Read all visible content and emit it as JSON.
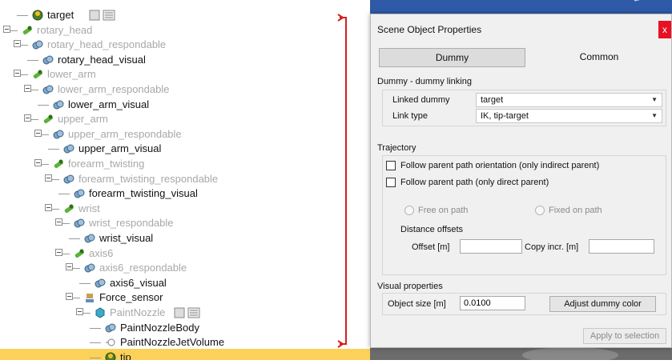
{
  "tree": {
    "rows": [
      {
        "label": "target",
        "style": "dark",
        "icon": "dummy-icon"
      },
      {
        "label": "rotary_head",
        "style": "dim",
        "icon": "joint-icon"
      },
      {
        "label": "rotary_head_respondable",
        "style": "dim",
        "icon": "shape-icon"
      },
      {
        "label": "rotary_head_visual",
        "style": "dark",
        "icon": "shape-icon"
      },
      {
        "label": "lower_arm",
        "style": "dim",
        "icon": "joint-icon"
      },
      {
        "label": "lower_arm_respondable",
        "style": "dim",
        "icon": "shape-icon"
      },
      {
        "label": "lower_arm_visual",
        "style": "dark",
        "icon": "shape-icon"
      },
      {
        "label": "upper_arm",
        "style": "dim",
        "icon": "joint-icon"
      },
      {
        "label": "upper_arm_respondable",
        "style": "dim",
        "icon": "shape-icon"
      },
      {
        "label": "upper_arm_visual",
        "style": "dark",
        "icon": "shape-icon"
      },
      {
        "label": "forearm_twisting",
        "style": "dim",
        "icon": "joint-icon"
      },
      {
        "label": "forearm_twisting_respondable",
        "style": "dim",
        "icon": "shape-icon"
      },
      {
        "label": "forearm_twisting_visual",
        "style": "dark",
        "icon": "shape-icon"
      },
      {
        "label": "wrist",
        "style": "dim",
        "icon": "joint-icon"
      },
      {
        "label": "wrist_respondable",
        "style": "dim",
        "icon": "shape-icon"
      },
      {
        "label": "wrist_visual",
        "style": "dark",
        "icon": "shape-icon"
      },
      {
        "label": "axis6",
        "style": "dim",
        "icon": "joint-icon"
      },
      {
        "label": "axis6_respondable",
        "style": "dim",
        "icon": "shape-icon"
      },
      {
        "label": "axis6_visual",
        "style": "dark",
        "icon": "shape-icon"
      },
      {
        "label": "Force_sensor",
        "style": "dark",
        "icon": "force-sensor-icon"
      },
      {
        "label": "PaintNozzle",
        "style": "dim",
        "icon": "cube-icon"
      },
      {
        "label": "PaintNozzleBody",
        "style": "dark",
        "icon": "shape-icon"
      },
      {
        "label": "PaintNozzleJetVolume",
        "style": "dark",
        "icon": "volume-icon"
      },
      {
        "label": "tip",
        "style": "dark",
        "icon": "dummy-icon",
        "selected": true
      }
    ]
  },
  "dialog": {
    "title": "Scene Object Properties",
    "close_label": "x",
    "tabs": {
      "dummy": "Dummy",
      "common": "Common"
    },
    "linking": {
      "section_title": "Dummy - dummy linking",
      "linked_dummy_label": "Linked dummy",
      "linked_dummy_value": "target",
      "link_type_label": "Link type",
      "link_type_value": "IK, tip-target"
    },
    "trajectory": {
      "section_title": "Trajectory",
      "follow_orientation": "Follow parent path orientation (only indirect parent)",
      "follow_path": "Follow parent path (only direct parent)",
      "free_on_path": "Free on path",
      "fixed_on_path": "Fixed on path",
      "distance_offsets": "Distance offsets",
      "offset_label": "Offset [m]",
      "copy_incr_label": "Copy incr. [m]"
    },
    "visual": {
      "section_title": "Visual properties",
      "object_size_label": "Object size [m]",
      "object_size_value": "0.0100",
      "adjust_color_button": "Adjust dummy color"
    },
    "apply_button": "Apply to selection"
  },
  "colors": {
    "selection": "#fcd15a",
    "annotation_red": "#d42020",
    "scene_blue": "#4e6a9c"
  }
}
